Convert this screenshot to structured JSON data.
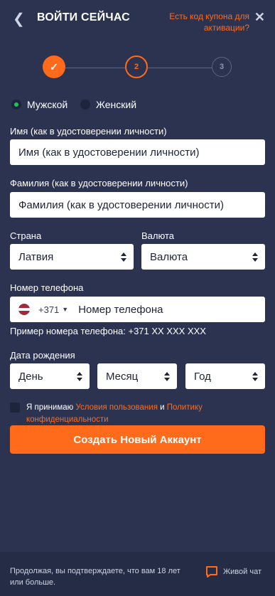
{
  "header": {
    "back_icon": "chevron-left-icon",
    "title": "ВОЙТИ СЕЙЧАС",
    "coupon_link": "Есть код купона для активации?",
    "close_icon": "close-icon"
  },
  "stepper": {
    "steps": [
      {
        "label": "✓",
        "state": "done"
      },
      {
        "label": "2",
        "state": "active"
      },
      {
        "label": "3",
        "state": "pending"
      }
    ]
  },
  "gender": {
    "male": "Мужской",
    "female": "Женский",
    "selected": "male"
  },
  "first_name": {
    "label": "Имя (как в удостоверении личности)",
    "placeholder": "Имя (как в удостоверении личности)"
  },
  "last_name": {
    "label": "Фамилия (как в удостоверении личности)",
    "placeholder": "Фамилия (как в удостоверении личности)"
  },
  "country": {
    "label": "Страна",
    "value": "Латвия"
  },
  "currency": {
    "label": "Валюта",
    "value": "Валюта"
  },
  "phone": {
    "label": "Номер телефона",
    "code": "+371",
    "placeholder": "Номер телефона",
    "hint": "Пример номера телефона: +371 XX XXX XXX"
  },
  "birthdate": {
    "label": "Дата рождения",
    "day": "День",
    "month": "Месяц",
    "year": "Год"
  },
  "terms": {
    "prefix": "Я принимаю ",
    "terms_link": "Условия пользования",
    "conjunction": " и ",
    "privacy_link": "Политику конфиденциальности"
  },
  "submit_label": "Создать Новый Аккаунт",
  "footer": {
    "text": "Продолжая, вы подтверждаете, что вам 18 лет или больше.",
    "chat_label": "Живой чат"
  },
  "colors": {
    "background": "#2b3350",
    "accent": "#ff6b1a",
    "footer_bg": "#252c46",
    "radio_selected": "#1fc25a"
  }
}
